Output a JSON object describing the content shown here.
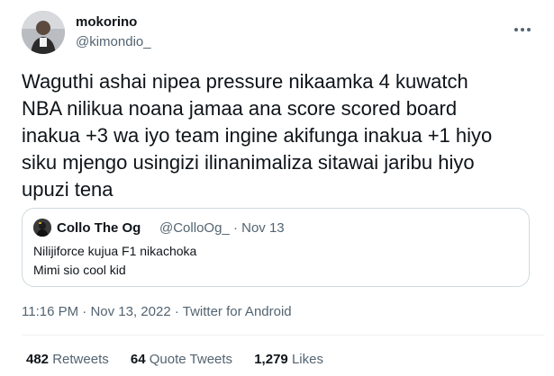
{
  "author": {
    "name": "mokorino",
    "handle": "@kimondio_"
  },
  "more_icon": "more-horizontal-icon",
  "tweet_text": "Waguthi ashai nipea pressure nikaamka 4 kuwatch\nNBA nilikua noana jamaa ana score scored board\ninakua +3 wa iyo team ingine akifunga inakua +1 hiyo\nsiku mjengo usingizi ilinanimaliza sitawai jaribu hiyo\nupuzi tena",
  "quote": {
    "name": "Collo The Og",
    "handle": "@ColloOg_",
    "separator": "·",
    "date": "Nov 13",
    "line1": "Nilijiforce kujua F1 nikachoka",
    "line2": "Mimi sio cool kid"
  },
  "timestamp": {
    "time": "11:16 PM",
    "separator": "·",
    "date": "Nov 13, 2022",
    "source": "Twitter for Android"
  },
  "stats": {
    "retweets_count": "482",
    "retweets_label": "Retweets",
    "quotes_count": "64",
    "quotes_label": "Quote Tweets",
    "likes_count": "1,279",
    "likes_label": "Likes"
  }
}
